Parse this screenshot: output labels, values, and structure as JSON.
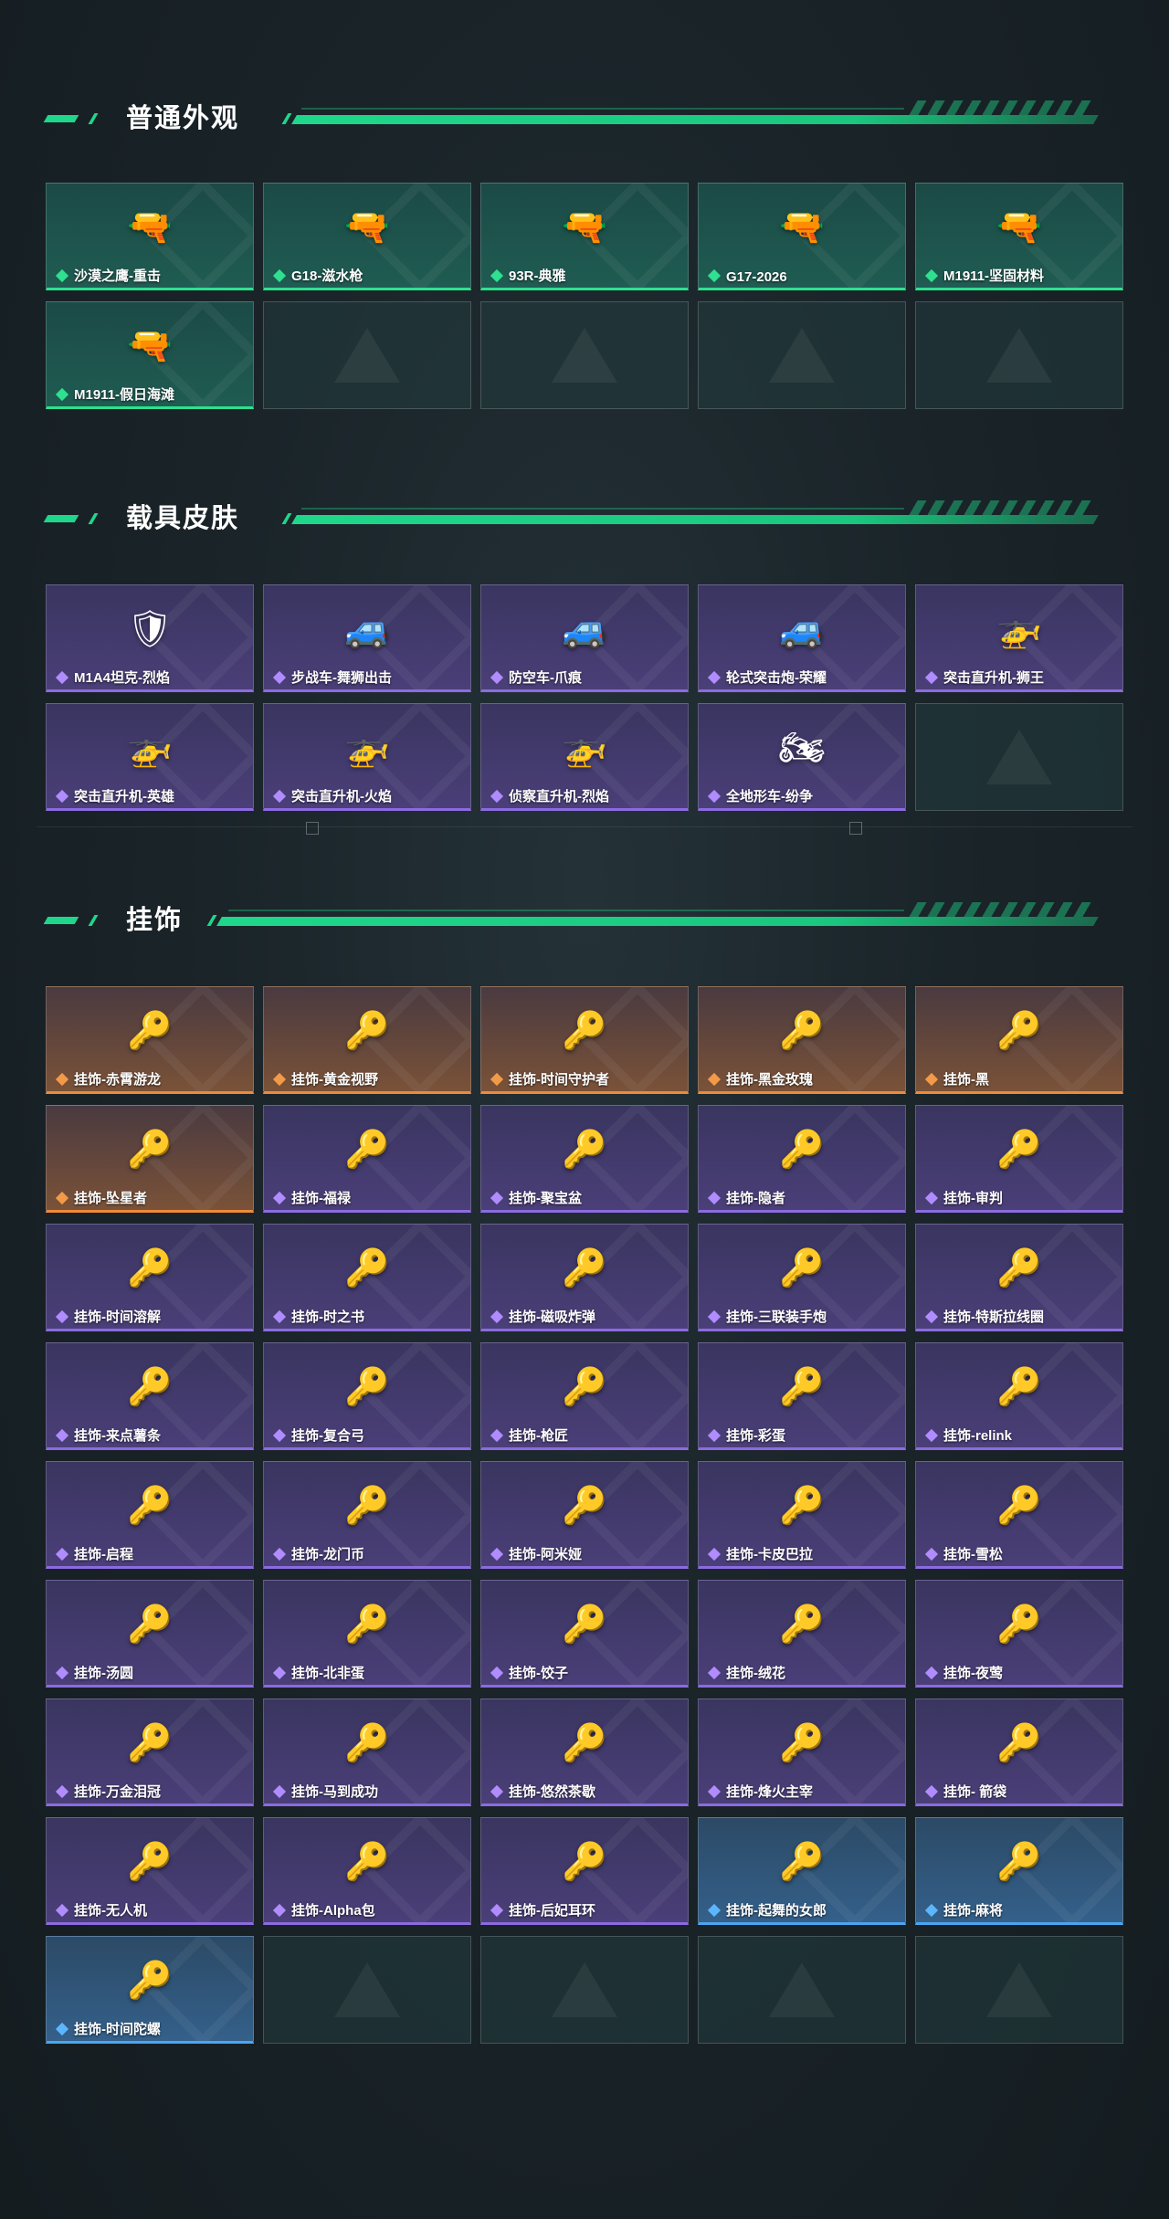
{
  "sections": [
    {
      "title": "普通外观",
      "items": [
        {
          "label": "沙漠之鹰-重击",
          "rarity": "green",
          "icon": "pistol"
        },
        {
          "label": "G18-滋水枪",
          "rarity": "green",
          "icon": "pistol"
        },
        {
          "label": "93R-典雅",
          "rarity": "green",
          "icon": "pistol"
        },
        {
          "label": "G17-2026",
          "rarity": "green",
          "icon": "pistol"
        },
        {
          "label": "M1911-坚固材料",
          "rarity": "green",
          "icon": "pistol"
        },
        {
          "label": "M1911-假日海滩",
          "rarity": "green",
          "icon": "pistol"
        },
        {
          "label": "",
          "rarity": "empty",
          "icon": ""
        },
        {
          "label": "",
          "rarity": "empty",
          "icon": ""
        },
        {
          "label": "",
          "rarity": "empty",
          "icon": ""
        },
        {
          "label": "",
          "rarity": "empty",
          "icon": ""
        }
      ]
    },
    {
      "title": "载具皮肤",
      "items": [
        {
          "label": "M1A4坦克-烈焰",
          "rarity": "purple",
          "icon": "tank"
        },
        {
          "label": "步战车-舞狮出击",
          "rarity": "purple",
          "icon": "ifv"
        },
        {
          "label": "防空车-爪痕",
          "rarity": "purple",
          "icon": "ifv"
        },
        {
          "label": "轮式突击炮-荣耀",
          "rarity": "purple",
          "icon": "ifv"
        },
        {
          "label": "突击直升机-狮王",
          "rarity": "purple",
          "icon": "heli"
        },
        {
          "label": "突击直升机-英雄",
          "rarity": "purple",
          "icon": "heli"
        },
        {
          "label": "突击直升机-火焰",
          "rarity": "purple",
          "icon": "heli"
        },
        {
          "label": "侦察直升机-烈焰",
          "rarity": "purple",
          "icon": "heli"
        },
        {
          "label": "全地形车-纷争",
          "rarity": "purple",
          "icon": "atv"
        },
        {
          "label": "",
          "rarity": "empty",
          "icon": ""
        }
      ]
    },
    {
      "title": "挂饰",
      "items": [
        {
          "label": "挂饰-赤霄游龙",
          "rarity": "orange",
          "icon": "charm"
        },
        {
          "label": "挂饰-黄金视野",
          "rarity": "orange",
          "icon": "charm"
        },
        {
          "label": "挂饰-时间守护者",
          "rarity": "orange",
          "icon": "charm"
        },
        {
          "label": "挂饰-黑金玫瑰",
          "rarity": "orange",
          "icon": "charm"
        },
        {
          "label": "挂饰-黑",
          "rarity": "orange",
          "icon": "charm"
        },
        {
          "label": "挂饰-坠星者",
          "rarity": "orange",
          "icon": "charm"
        },
        {
          "label": "挂饰-福禄",
          "rarity": "purple",
          "icon": "charm"
        },
        {
          "label": "挂饰-聚宝盆",
          "rarity": "purple",
          "icon": "charm"
        },
        {
          "label": "挂饰-隐者",
          "rarity": "purple",
          "icon": "charm"
        },
        {
          "label": "挂饰-审判",
          "rarity": "purple",
          "icon": "charm"
        },
        {
          "label": "挂饰-时间溶解",
          "rarity": "purple",
          "icon": "charm"
        },
        {
          "label": "挂饰-时之书",
          "rarity": "purple",
          "icon": "charm"
        },
        {
          "label": "挂饰-磁吸炸弹",
          "rarity": "purple",
          "icon": "charm"
        },
        {
          "label": "挂饰-三联装手炮",
          "rarity": "purple",
          "icon": "charm"
        },
        {
          "label": "挂饰-特斯拉线圈",
          "rarity": "purple",
          "icon": "charm"
        },
        {
          "label": "挂饰-来点薯条",
          "rarity": "purple",
          "icon": "charm"
        },
        {
          "label": "挂饰-复合弓",
          "rarity": "purple",
          "icon": "charm"
        },
        {
          "label": "挂饰-枪匠",
          "rarity": "purple",
          "icon": "charm"
        },
        {
          "label": "挂饰-彩蛋",
          "rarity": "purple",
          "icon": "charm"
        },
        {
          "label": "挂饰-relink",
          "rarity": "purple",
          "icon": "charm"
        },
        {
          "label": "挂饰-启程",
          "rarity": "purple",
          "icon": "charm"
        },
        {
          "label": "挂饰-龙门币",
          "rarity": "purple",
          "icon": "charm"
        },
        {
          "label": "挂饰-阿米娅",
          "rarity": "purple",
          "icon": "charm"
        },
        {
          "label": "挂饰-卡皮巴拉",
          "rarity": "purple",
          "icon": "charm"
        },
        {
          "label": "挂饰-雪松",
          "rarity": "purple",
          "icon": "charm"
        },
        {
          "label": "挂饰-汤圆",
          "rarity": "purple",
          "icon": "charm"
        },
        {
          "label": "挂饰-北非蛋",
          "rarity": "purple",
          "icon": "charm"
        },
        {
          "label": "挂饰-饺子",
          "rarity": "purple",
          "icon": "charm"
        },
        {
          "label": "挂饰-绒花",
          "rarity": "purple",
          "icon": "charm"
        },
        {
          "label": "挂饰-夜莺",
          "rarity": "purple",
          "icon": "charm"
        },
        {
          "label": "挂饰-万金泪冠",
          "rarity": "purple",
          "icon": "charm"
        },
        {
          "label": "挂饰-马到成功",
          "rarity": "purple",
          "icon": "charm"
        },
        {
          "label": "挂饰-悠然茶歇",
          "rarity": "purple",
          "icon": "charm"
        },
        {
          "label": "挂饰-烽火主宰",
          "rarity": "purple",
          "icon": "charm"
        },
        {
          "label": "挂饰- 箭袋",
          "rarity": "purple",
          "icon": "charm"
        },
        {
          "label": "挂饰-无人机",
          "rarity": "purple",
          "icon": "charm"
        },
        {
          "label": "挂饰-Alpha包",
          "rarity": "purple",
          "icon": "charm"
        },
        {
          "label": "挂饰-后妃耳环",
          "rarity": "purple",
          "icon": "charm"
        },
        {
          "label": "挂饰-起舞的女郎",
          "rarity": "blue",
          "icon": "charm"
        },
        {
          "label": "挂饰-麻将",
          "rarity": "blue",
          "icon": "charm"
        },
        {
          "label": "挂饰-时间陀螺",
          "rarity": "blue",
          "icon": "charm"
        },
        {
          "label": "",
          "rarity": "empty",
          "icon": ""
        },
        {
          "label": "",
          "rarity": "empty",
          "icon": ""
        },
        {
          "label": "",
          "rarity": "empty",
          "icon": ""
        },
        {
          "label": "",
          "rarity": "empty",
          "icon": ""
        }
      ]
    }
  ]
}
